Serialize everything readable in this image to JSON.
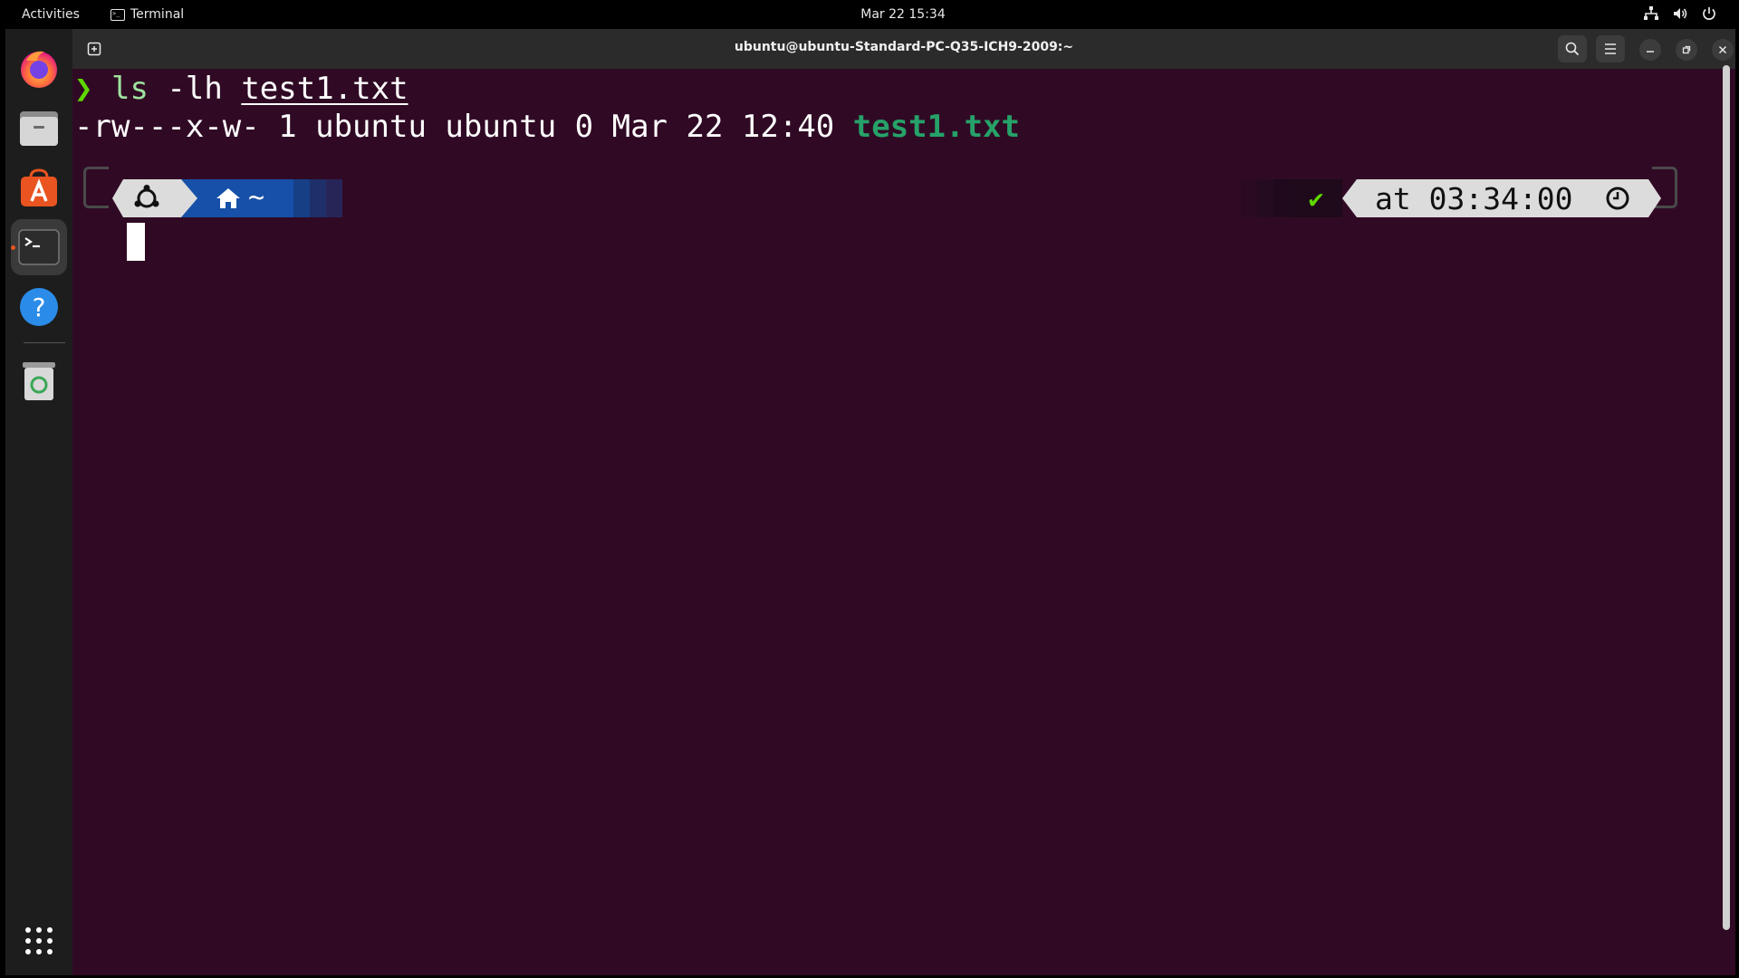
{
  "topbar": {
    "activities": "Activities",
    "app_name": "Terminal",
    "clock": "Mar 22  15:34",
    "icons": [
      "network-icon",
      "volume-icon",
      "power-icon"
    ]
  },
  "dock": {
    "items": [
      {
        "name": "Firefox",
        "icon": "firefox-icon"
      },
      {
        "name": "Files",
        "icon": "files-icon"
      },
      {
        "name": "Ubuntu Software",
        "icon": "software-icon"
      },
      {
        "name": "Terminal",
        "icon": "terminal-icon",
        "active": true
      },
      {
        "name": "Help",
        "icon": "help-icon"
      },
      {
        "name": "Trash",
        "icon": "trash-icon"
      },
      {
        "name": "Show Applications",
        "icon": "app-grid-icon"
      }
    ]
  },
  "window": {
    "title": "ubuntu@ubuntu-Standard-PC-Q35-ICH9-2009:~",
    "buttons": [
      "new-tab-icon",
      "search-icon",
      "menu-icon",
      "minimize-icon",
      "restore-icon",
      "close-icon"
    ]
  },
  "terminal": {
    "prompt_symbol": "❯",
    "command": "ls",
    "command_args": "-lh",
    "command_file": "test1.txt",
    "output_prefix": "-rw---x-w- 1 ubuntu ubuntu 0 Mar 22 12:40",
    "output_file": "test1.txt",
    "prompt_dir_symbol": "~",
    "status_check": "✔",
    "time_text": "at 03:34:00"
  },
  "colors": {
    "terminal_bg": "#300a24",
    "prompt_green": "#5fd700",
    "file_green": "#26a269",
    "dir_segment": "#1750a8",
    "segment_light": "#dcdcdc"
  }
}
